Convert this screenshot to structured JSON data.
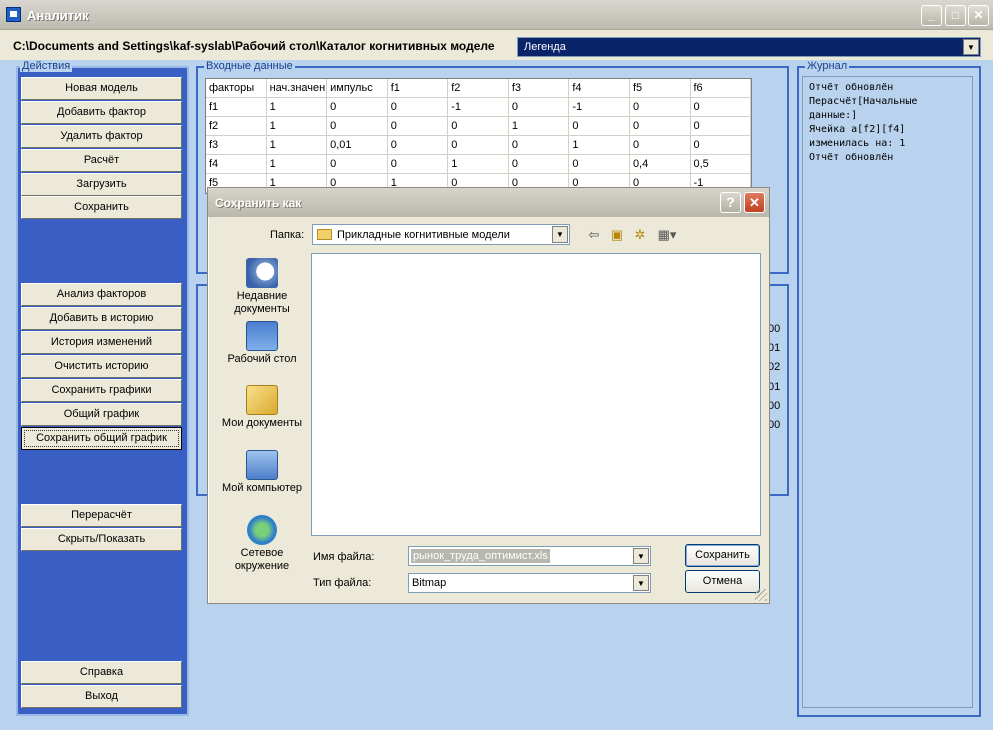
{
  "window": {
    "title": "Аналитик"
  },
  "path": {
    "text": "C:\\Documents and Settings\\kaf-syslab\\Рабочий стол\\Каталог когнитивных моделе"
  },
  "legend_combo": {
    "value": "Легенда"
  },
  "groups": {
    "actions": "Действия",
    "input": "Входные данные",
    "journal": "Журнал"
  },
  "actions": {
    "top": [
      "Новая модель",
      "Добавить фактор",
      "Удалить фактор",
      "Расчёт",
      "Загрузить",
      "Сохранить"
    ],
    "middle": [
      "Анализ факторов",
      "Добавить в историю",
      "История изменений",
      "Очистить историю",
      "Сохранить графики",
      "Общий график",
      "Сохранить общий график"
    ],
    "recalc": [
      "Перерасчёт",
      "Скрыть/Показать"
    ],
    "bottom": [
      "Справка",
      "Выход"
    ]
  },
  "grid": {
    "headers": [
      "факторы",
      "нач.значени",
      "импульс",
      "f1",
      "f2",
      "f3",
      "f4",
      "f5",
      "f6"
    ],
    "rows": [
      [
        "f1",
        "1",
        "0",
        "0",
        "-1",
        "0",
        "-1",
        "0",
        "0"
      ],
      [
        "f2",
        "1",
        "0",
        "0",
        "0",
        "1",
        "0",
        "0",
        "0"
      ],
      [
        "f3",
        "1",
        "0,01",
        "0",
        "0",
        "0",
        "1",
        "0",
        "0"
      ],
      [
        "f4",
        "1",
        "0",
        "0",
        "1",
        "0",
        "0",
        "0,4",
        "0,5"
      ],
      [
        "f5",
        "1",
        "0",
        "1",
        "0",
        "0",
        "0",
        "0",
        "-1"
      ]
    ]
  },
  "behind_values": [
    "00",
    "01",
    "02",
    "01",
    "00",
    "00"
  ],
  "journal": {
    "text": "Отчёт обновлён\nПерасчёт[Начальные данные:]\nЯчейка a[f2][f4] изменилась на: 1\nОтчёт обновлён"
  },
  "dialog": {
    "title": "Сохранить как",
    "help": "?",
    "close": "✕",
    "folder_label": "Папка:",
    "folder_value": "Прикладные когнитивные модели",
    "places": [
      "Недавние документы",
      "Рабочий стол",
      "Мои документы",
      "Мой компьютер",
      "Сетевое окружение"
    ],
    "filename_label": "Имя файла:",
    "filename_value": "рынок_труда_оптимист.xls",
    "filetype_label": "Тип файла:",
    "filetype_value": "Bitmap",
    "save_button": "Сохранить",
    "cancel_button": "Отмена"
  },
  "icons": {
    "back": "back-arrow-icon",
    "up": "up-folder-icon",
    "new": "new-folder-icon",
    "view": "view-menu-icon"
  },
  "colors": {
    "side_panel": "#3a5fc4",
    "background": "#b9d3ee",
    "title_bar": "#0a246a"
  }
}
